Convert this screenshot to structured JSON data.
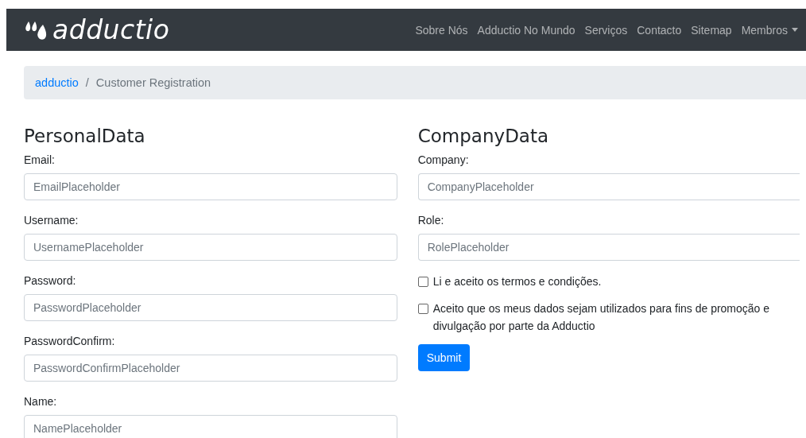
{
  "navbar": {
    "brand": "adductio",
    "links": [
      {
        "label": "Sobre Nós",
        "dropdown": false
      },
      {
        "label": "Adductio No Mundo",
        "dropdown": false
      },
      {
        "label": "Serviços",
        "dropdown": false
      },
      {
        "label": "Contacto",
        "dropdown": false
      },
      {
        "label": "Sitemap",
        "dropdown": false
      },
      {
        "label": "Membros",
        "dropdown": true
      }
    ]
  },
  "breadcrumb": {
    "link": "adductio",
    "separator": "/",
    "current": "Customer Registration"
  },
  "personal": {
    "title": "PersonalData",
    "fields": [
      {
        "label": "Email:",
        "placeholder": "EmailPlaceholder"
      },
      {
        "label": "Username:",
        "placeholder": "UsernamePlaceholder"
      },
      {
        "label": "Password:",
        "placeholder": "PasswordPlaceholder"
      },
      {
        "label": "PasswordConfirm:",
        "placeholder": "PasswordConfirmPlaceholder"
      },
      {
        "label": "Name:",
        "placeholder": "NamePlaceholder"
      }
    ]
  },
  "company": {
    "title": "CompanyData",
    "fields": [
      {
        "label": "Company:",
        "placeholder": "CompanyPlaceholder"
      },
      {
        "label": "Role:",
        "placeholder": "RolePlaceholder"
      }
    ],
    "checkboxes": [
      {
        "label": "Li e aceito os termos e condições.",
        "checked": false
      },
      {
        "label": "Aceito que os meus dados sejam utilizados para fins de promoção e divulgação por parte da Adductio",
        "checked": false
      }
    ],
    "submit": "Submit"
  }
}
